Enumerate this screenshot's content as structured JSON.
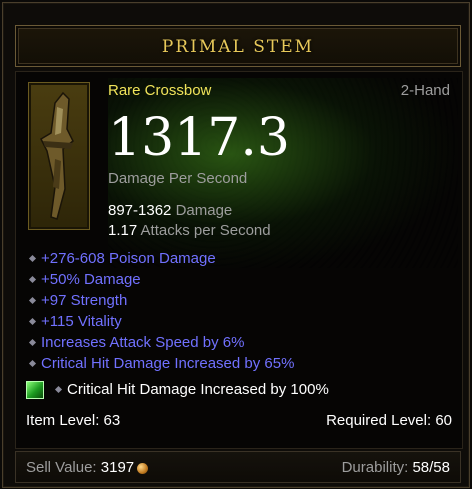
{
  "item": {
    "name": "PRIMAL STEM",
    "type": "Rare Crossbow",
    "hand": "2-Hand",
    "dps": "1317.3",
    "dps_label": "Damage Per Second",
    "damage_range": "897-1362",
    "damage_label": "Damage",
    "attacks_value": "1.17",
    "attacks_label": "Attacks per Second",
    "affixes": [
      "+276-608 Poison Damage",
      "+50% Damage",
      "+97 Strength",
      "+115 Vitality",
      "Increases Attack Speed by 6%",
      "Critical Hit Damage Increased by 65%"
    ],
    "socket_bonus": "Critical Hit Damage Increased by 100%",
    "item_level_label": "Item Level:",
    "item_level": "63",
    "required_level_label": "Required Level:",
    "required_level": "60",
    "sell_label": "Sell Value:",
    "sell_value": "3197",
    "durability_label": "Durability:",
    "durability": "58/58"
  },
  "colors": {
    "title": "#e8c95a",
    "rare": "#f0e35a",
    "magic_affix": "#7171ff",
    "gray_text": "#9d9d9d",
    "gem": "#1c9a20"
  },
  "icons": [
    "crossbow-icon",
    "emerald-gem-icon",
    "gold-coin-icon",
    "bullet-icon"
  ]
}
